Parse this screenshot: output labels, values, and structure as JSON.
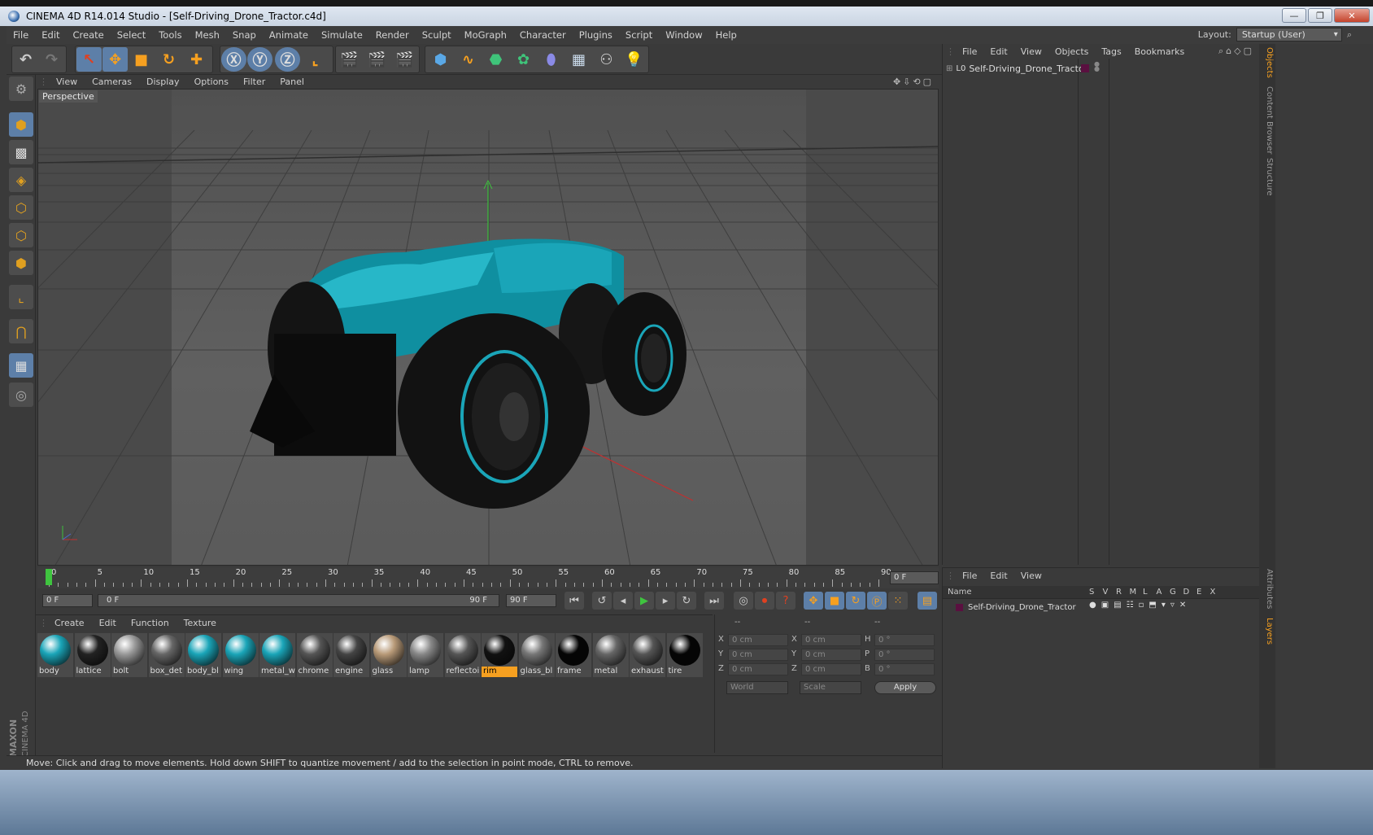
{
  "window": {
    "title": "CINEMA 4D R14.014 Studio - [Self-Driving_Drone_Tractor.c4d]"
  },
  "menu": [
    "File",
    "Edit",
    "Create",
    "Select",
    "Tools",
    "Mesh",
    "Snap",
    "Animate",
    "Simulate",
    "Render",
    "Sculpt",
    "MoGraph",
    "Character",
    "Plugins",
    "Script",
    "Window",
    "Help"
  ],
  "layout": {
    "label": "Layout:",
    "value": "Startup (User)"
  },
  "viewport": {
    "menu": [
      "View",
      "Cameras",
      "Display",
      "Options",
      "Filter",
      "Panel"
    ],
    "label": "Perspective"
  },
  "timeline": {
    "ticks": [
      "0",
      "5",
      "10",
      "15",
      "20",
      "25",
      "30",
      "35",
      "40",
      "45",
      "50",
      "55",
      "60",
      "65",
      "70",
      "75",
      "80",
      "85",
      "90"
    ],
    "end_frame": "0 F",
    "start_field": "0 F",
    "range_start": "0 F",
    "range_end": "90 F",
    "max_field": "90 F"
  },
  "materials": {
    "menu": [
      "Create",
      "Edit",
      "Function",
      "Texture"
    ],
    "items": [
      {
        "name": "body",
        "color": "#1aa5b8"
      },
      {
        "name": "lattice",
        "color": "#222"
      },
      {
        "name": "bolt",
        "color": "#999"
      },
      {
        "name": "box_det",
        "color": "#666"
      },
      {
        "name": "body_bl",
        "color": "#1aa5b8"
      },
      {
        "name": "wing",
        "color": "#1aa5b8"
      },
      {
        "name": "metal_w",
        "color": "#1aa5b8"
      },
      {
        "name": "chrome",
        "color": "#555"
      },
      {
        "name": "engine",
        "color": "#444"
      },
      {
        "name": "glass",
        "color": "#b89a78"
      },
      {
        "name": "lamp",
        "color": "#888"
      },
      {
        "name": "reflectoi",
        "color": "#555"
      },
      {
        "name": "rim",
        "color": "#111",
        "selected": true
      },
      {
        "name": "glass_bl",
        "color": "#777"
      },
      {
        "name": "frame",
        "color": "#050505"
      },
      {
        "name": "metal",
        "color": "#666"
      },
      {
        "name": "exhaust",
        "color": "#555"
      },
      {
        "name": "tire",
        "color": "#050505"
      }
    ]
  },
  "coords": {
    "headers": [
      "--",
      "--",
      "--"
    ],
    "rows": [
      {
        "a": "X",
        "av": "0 cm",
        "b": "X",
        "bv": "0 cm",
        "c": "H",
        "cv": "0 °"
      },
      {
        "a": "Y",
        "av": "0 cm",
        "b": "Y",
        "bv": "0 cm",
        "c": "P",
        "cv": "0 °"
      },
      {
        "a": "Z",
        "av": "0 cm",
        "b": "Z",
        "bv": "0 cm",
        "c": "B",
        "cv": "0 °"
      }
    ],
    "space": "World",
    "mode": "Scale",
    "apply": "Apply"
  },
  "objects": {
    "menu": [
      "File",
      "Edit",
      "View",
      "Objects",
      "Tags",
      "Bookmarks"
    ],
    "tree": [
      {
        "name": "Self-Driving_Drone_Tractor"
      }
    ]
  },
  "layers": {
    "menu": [
      "File",
      "Edit",
      "View"
    ],
    "header_name": "Name",
    "columns": [
      "S",
      "V",
      "R",
      "M",
      "L",
      "A",
      "G",
      "D",
      "E",
      "X"
    ],
    "rows": [
      {
        "name": "Self-Driving_Drone_Tractor"
      }
    ]
  },
  "side_tabs": [
    "Objects",
    "Content Browser",
    "Structure",
    "Attributes",
    "Layers"
  ],
  "brand": {
    "maxon": "MAXON",
    "cinema": "CINEMA 4D"
  },
  "status": "Move: Click and drag to move elements. Hold down SHIFT to quantize movement / add to the selection in point mode, CTRL to remove.",
  "colors": {
    "accent": "#f6a020",
    "teal": "#1aa5b8",
    "select": "#5d7fa8"
  }
}
